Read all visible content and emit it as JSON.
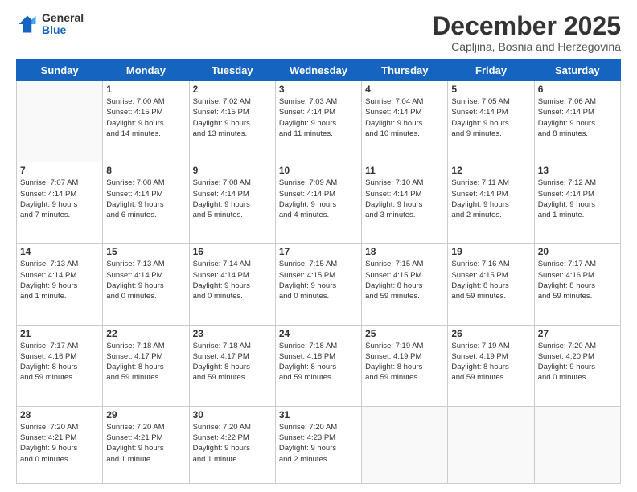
{
  "logo": {
    "general": "General",
    "blue": "Blue"
  },
  "header": {
    "month": "December 2025",
    "location": "Capljina, Bosnia and Herzegovina"
  },
  "weekdays": [
    "Sunday",
    "Monday",
    "Tuesday",
    "Wednesday",
    "Thursday",
    "Friday",
    "Saturday"
  ],
  "weeks": [
    [
      {
        "day": "",
        "info": ""
      },
      {
        "day": "1",
        "info": "Sunrise: 7:00 AM\nSunset: 4:15 PM\nDaylight: 9 hours\nand 14 minutes."
      },
      {
        "day": "2",
        "info": "Sunrise: 7:02 AM\nSunset: 4:15 PM\nDaylight: 9 hours\nand 13 minutes."
      },
      {
        "day": "3",
        "info": "Sunrise: 7:03 AM\nSunset: 4:14 PM\nDaylight: 9 hours\nand 11 minutes."
      },
      {
        "day": "4",
        "info": "Sunrise: 7:04 AM\nSunset: 4:14 PM\nDaylight: 9 hours\nand 10 minutes."
      },
      {
        "day": "5",
        "info": "Sunrise: 7:05 AM\nSunset: 4:14 PM\nDaylight: 9 hours\nand 9 minutes."
      },
      {
        "day": "6",
        "info": "Sunrise: 7:06 AM\nSunset: 4:14 PM\nDaylight: 9 hours\nand 8 minutes."
      }
    ],
    [
      {
        "day": "7",
        "info": "Sunrise: 7:07 AM\nSunset: 4:14 PM\nDaylight: 9 hours\nand 7 minutes."
      },
      {
        "day": "8",
        "info": "Sunrise: 7:08 AM\nSunset: 4:14 PM\nDaylight: 9 hours\nand 6 minutes."
      },
      {
        "day": "9",
        "info": "Sunrise: 7:08 AM\nSunset: 4:14 PM\nDaylight: 9 hours\nand 5 minutes."
      },
      {
        "day": "10",
        "info": "Sunrise: 7:09 AM\nSunset: 4:14 PM\nDaylight: 9 hours\nand 4 minutes."
      },
      {
        "day": "11",
        "info": "Sunrise: 7:10 AM\nSunset: 4:14 PM\nDaylight: 9 hours\nand 3 minutes."
      },
      {
        "day": "12",
        "info": "Sunrise: 7:11 AM\nSunset: 4:14 PM\nDaylight: 9 hours\nand 2 minutes."
      },
      {
        "day": "13",
        "info": "Sunrise: 7:12 AM\nSunset: 4:14 PM\nDaylight: 9 hours\nand 1 minute."
      }
    ],
    [
      {
        "day": "14",
        "info": "Sunrise: 7:13 AM\nSunset: 4:14 PM\nDaylight: 9 hours\nand 1 minute."
      },
      {
        "day": "15",
        "info": "Sunrise: 7:13 AM\nSunset: 4:14 PM\nDaylight: 9 hours\nand 0 minutes."
      },
      {
        "day": "16",
        "info": "Sunrise: 7:14 AM\nSunset: 4:14 PM\nDaylight: 9 hours\nand 0 minutes."
      },
      {
        "day": "17",
        "info": "Sunrise: 7:15 AM\nSunset: 4:15 PM\nDaylight: 9 hours\nand 0 minutes."
      },
      {
        "day": "18",
        "info": "Sunrise: 7:15 AM\nSunset: 4:15 PM\nDaylight: 8 hours\nand 59 minutes."
      },
      {
        "day": "19",
        "info": "Sunrise: 7:16 AM\nSunset: 4:15 PM\nDaylight: 8 hours\nand 59 minutes."
      },
      {
        "day": "20",
        "info": "Sunrise: 7:17 AM\nSunset: 4:16 PM\nDaylight: 8 hours\nand 59 minutes."
      }
    ],
    [
      {
        "day": "21",
        "info": "Sunrise: 7:17 AM\nSunset: 4:16 PM\nDaylight: 8 hours\nand 59 minutes."
      },
      {
        "day": "22",
        "info": "Sunrise: 7:18 AM\nSunset: 4:17 PM\nDaylight: 8 hours\nand 59 minutes."
      },
      {
        "day": "23",
        "info": "Sunrise: 7:18 AM\nSunset: 4:17 PM\nDaylight: 8 hours\nand 59 minutes."
      },
      {
        "day": "24",
        "info": "Sunrise: 7:18 AM\nSunset: 4:18 PM\nDaylight: 8 hours\nand 59 minutes."
      },
      {
        "day": "25",
        "info": "Sunrise: 7:19 AM\nSunset: 4:19 PM\nDaylight: 8 hours\nand 59 minutes."
      },
      {
        "day": "26",
        "info": "Sunrise: 7:19 AM\nSunset: 4:19 PM\nDaylight: 8 hours\nand 59 minutes."
      },
      {
        "day": "27",
        "info": "Sunrise: 7:20 AM\nSunset: 4:20 PM\nDaylight: 9 hours\nand 0 minutes."
      }
    ],
    [
      {
        "day": "28",
        "info": "Sunrise: 7:20 AM\nSunset: 4:21 PM\nDaylight: 9 hours\nand 0 minutes."
      },
      {
        "day": "29",
        "info": "Sunrise: 7:20 AM\nSunset: 4:21 PM\nDaylight: 9 hours\nand 1 minute."
      },
      {
        "day": "30",
        "info": "Sunrise: 7:20 AM\nSunset: 4:22 PM\nDaylight: 9 hours\nand 1 minute."
      },
      {
        "day": "31",
        "info": "Sunrise: 7:20 AM\nSunset: 4:23 PM\nDaylight: 9 hours\nand 2 minutes."
      },
      {
        "day": "",
        "info": ""
      },
      {
        "day": "",
        "info": ""
      },
      {
        "day": "",
        "info": ""
      }
    ]
  ]
}
